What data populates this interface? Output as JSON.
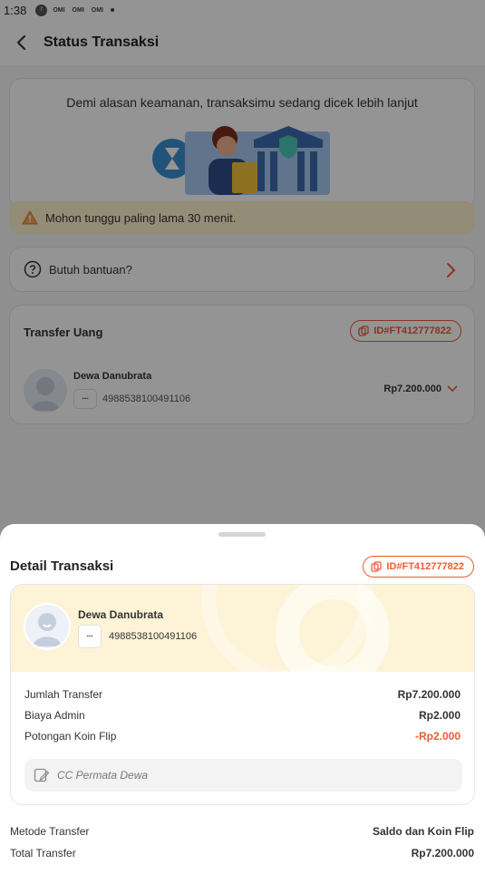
{
  "status_bar": {
    "time": "1:38",
    "notif_labels": [
      "OMI",
      "OMI",
      "OMI"
    ]
  },
  "appbar": {
    "title": "Status Transaksi"
  },
  "security": {
    "message": "Demi alasan keamanan, transaksimu sedang dicek lebih lanjut"
  },
  "warning": {
    "text": "Mohon tunggu paling lama 30 menit."
  },
  "help": {
    "label": "Butuh bantuan?"
  },
  "transfer_card": {
    "label": "Transfer Uang",
    "transaction_id": "ID#FT412777822",
    "recipient_name": "Dewa Danubrata",
    "account_number": "4988538100491106",
    "amount": "Rp7.200.000"
  },
  "detail_sheet": {
    "title": "Detail Transaksi",
    "transaction_id": "ID#FT412777822",
    "recipient_name": "Dewa Danubrata",
    "account_number": "4988538100491106",
    "rows": [
      {
        "label": "Jumlah Transfer",
        "value": "Rp7.200.000"
      },
      {
        "label": "Biaya Admin",
        "value": "Rp2.000"
      },
      {
        "label": "Potongan Koin Flip",
        "value": "-Rp2.000"
      }
    ],
    "note": "CC Permata Dewa",
    "footer": [
      {
        "label": "Metode Transfer",
        "value": "Saldo dan Koin Flip"
      },
      {
        "label": "Total Transfer",
        "value": "Rp7.200.000"
      }
    ]
  },
  "colors": {
    "accent": "#f05b33",
    "warning_bg": "#fdf1cc",
    "header_bg": "#fdf3d7"
  }
}
